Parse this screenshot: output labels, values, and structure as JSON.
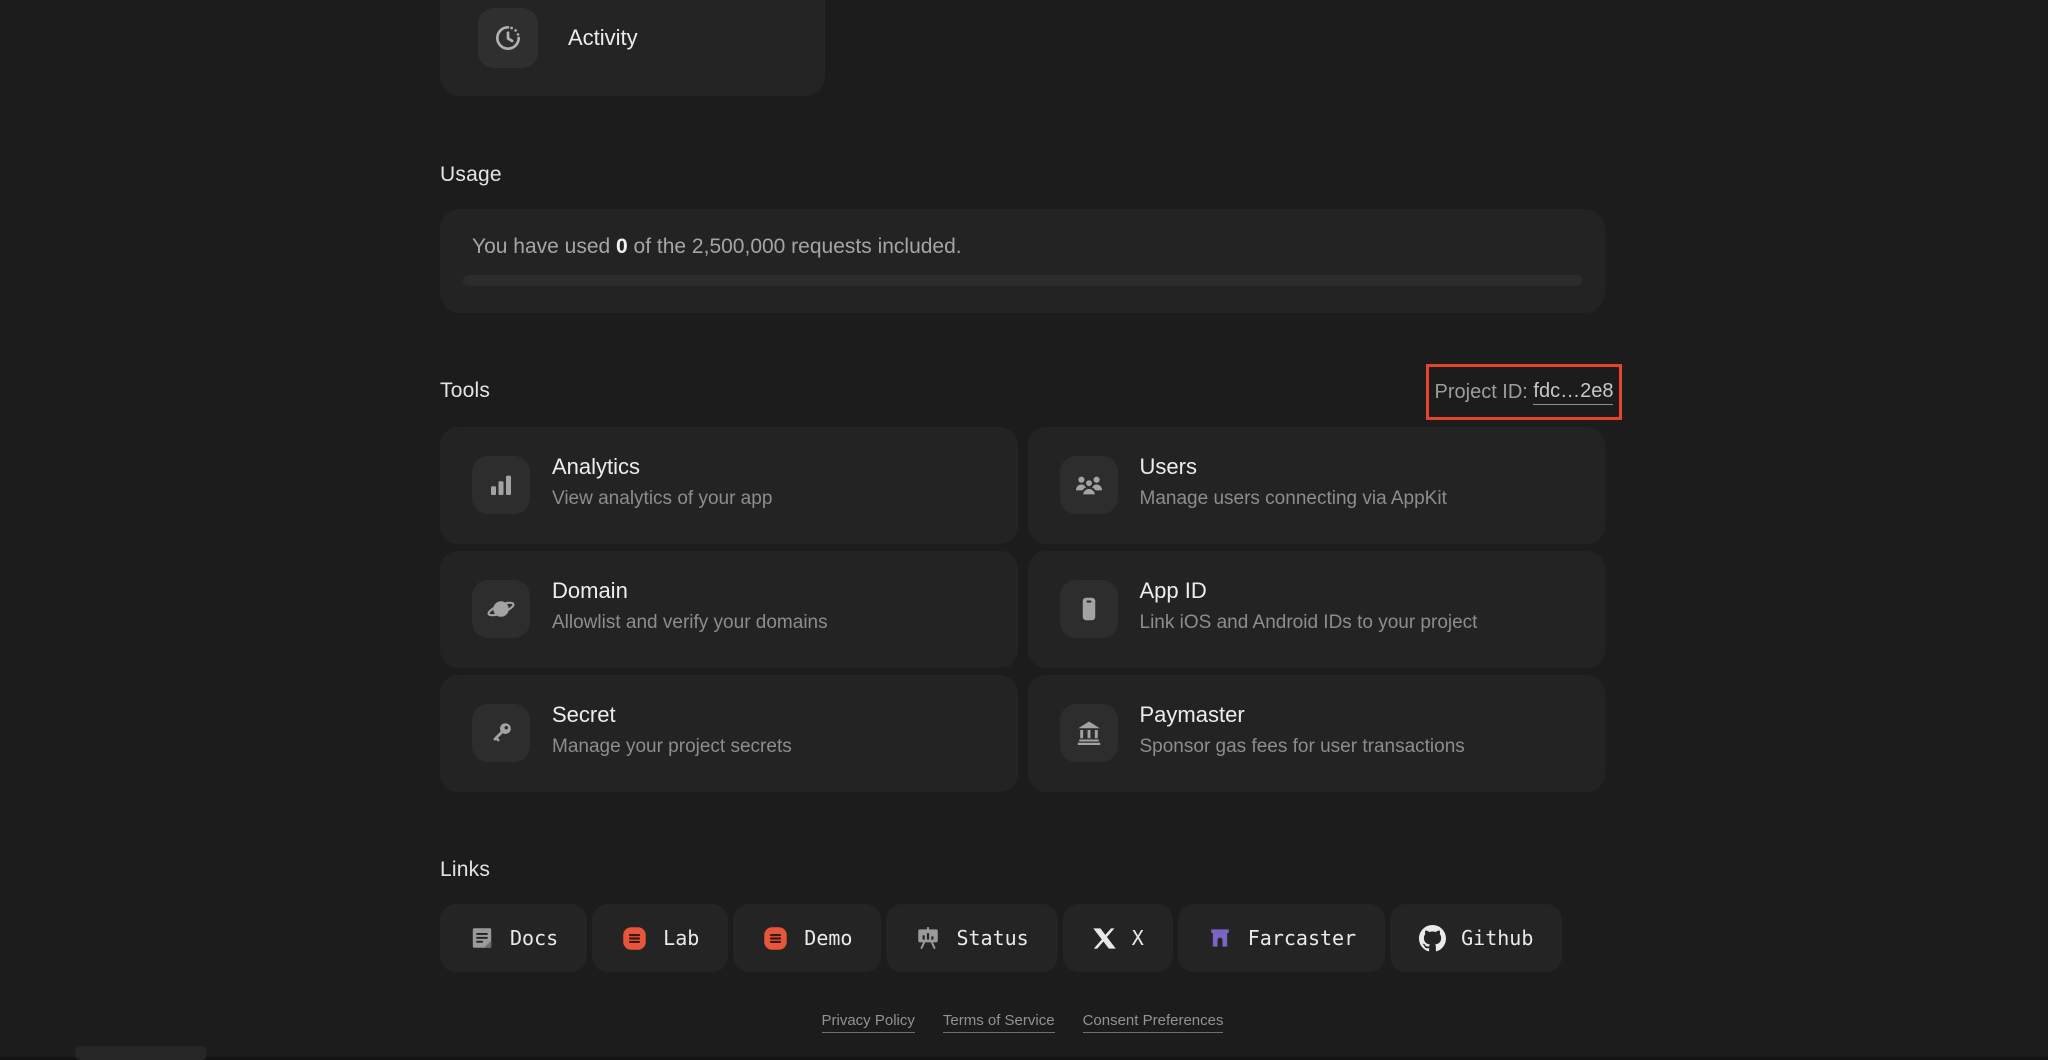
{
  "activity_card": {
    "label": "Activity"
  },
  "usage": {
    "heading": "Usage",
    "text_prefix": "You have used ",
    "used_value": "0",
    "text_suffix": " of the 2,500,000 requests included.",
    "progress_percent": 0
  },
  "tools": {
    "heading": "Tools",
    "project_id": {
      "label": "Project ID: ",
      "value": "fdc…2e8",
      "highlight_color": "#e8432c"
    },
    "cards": [
      {
        "icon": "bar-chart-icon",
        "title": "Analytics",
        "description": "View analytics of your app"
      },
      {
        "icon": "users-icon",
        "title": "Users",
        "description": "Manage users connecting via AppKit"
      },
      {
        "icon": "planet-icon",
        "title": "Domain",
        "description": "Allowlist and verify your domains"
      },
      {
        "icon": "phone-icon",
        "title": "App ID",
        "description": "Link iOS and Android IDs to your project"
      },
      {
        "icon": "key-icon",
        "title": "Secret",
        "description": "Manage your project secrets"
      },
      {
        "icon": "bank-icon",
        "title": "Paymaster",
        "description": "Sponsor gas fees for user transactions"
      }
    ]
  },
  "links": {
    "heading": "Links",
    "items": [
      {
        "icon": "docs-icon",
        "label": "Docs"
      },
      {
        "icon": "reown-lab-icon",
        "label": "Lab"
      },
      {
        "icon": "reown-demo-icon",
        "label": "Demo"
      },
      {
        "icon": "status-board-icon",
        "label": "Status"
      },
      {
        "icon": "x-logo-icon",
        "label": "X"
      },
      {
        "icon": "farcaster-icon",
        "label": "Farcaster"
      },
      {
        "icon": "github-icon",
        "label": "Github"
      }
    ]
  },
  "footer": {
    "links": [
      "Privacy Policy",
      "Terms of Service",
      "Consent Preferences"
    ]
  },
  "colors": {
    "page_background": "#1c1c1c",
    "card_background": "#232323",
    "icon_tile_background": "#2d2d2e",
    "highlight_red": "#e8432c",
    "brand_orange": "#e7553a",
    "farcaster_purple": "#7b64c5",
    "title_text": "#ededed",
    "muted_text": "#8d8d8d"
  }
}
